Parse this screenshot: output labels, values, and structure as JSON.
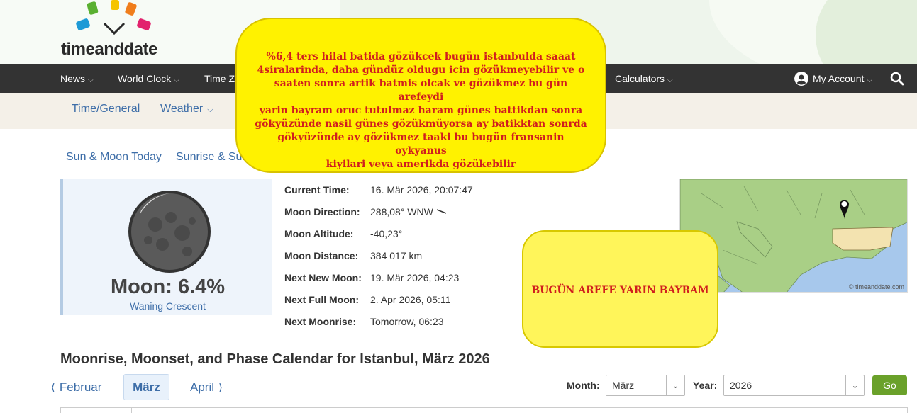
{
  "brand": {
    "logo_text": "timeanddate"
  },
  "topnav": {
    "items": [
      {
        "label": "News"
      },
      {
        "label": "World Clock"
      },
      {
        "label": "Time Zo"
      },
      {
        "label": "Calculators"
      }
    ],
    "account_label": "My Account"
  },
  "subnav": {
    "items": [
      {
        "label": "Time/General"
      },
      {
        "label": "Weather"
      }
    ]
  },
  "tabs": [
    {
      "label": "Sun & Moon Today"
    },
    {
      "label": "Sunrise & Sun"
    }
  ],
  "moon": {
    "percent": "Moon: 6.4%",
    "phase": "Waning Crescent"
  },
  "info": [
    {
      "label": "Current Time:",
      "value": "16. Mär 2026, 20:07:47"
    },
    {
      "label": "Moon Direction:",
      "value": "288,08° WNW"
    },
    {
      "label": "Moon Altitude:",
      "value": "-40,23°"
    },
    {
      "label": "Moon Distance:",
      "value": "384 017 km"
    },
    {
      "label": "Next New Moon:",
      "value": "19. Mär 2026, 04:23"
    },
    {
      "label": "Next Full Moon:",
      "value": "2. Apr 2026, 05:11"
    },
    {
      "label": "Next Moonrise:",
      "value": "Tomorrow, 06:23"
    }
  ],
  "map": {
    "credit": "© timeanddate.com"
  },
  "calendar": {
    "title": "Moonrise, Moonset, and Phase Calendar for Istanbul, März 2026",
    "prev_month": "Februar",
    "current_month": "März",
    "next_month": "April",
    "month_label": "Month:",
    "month_value": "März",
    "year_label": "Year:",
    "year_value": "2026",
    "go_label": "Go"
  },
  "annotations": {
    "bubble1_lines": [
      "%6,4 ters hilal batida gözükcek bugün istanbulda saaat",
      "4siralarinda,  daha gündüz oldugu icin gözükmeyebilir ve o",
      "saaten sonra artik batmis olcak ve gözükmez  bu gün arefeydi",
      "yarin bayram oruc tutulmaz haram günes battikdan sonra",
      "gökyüzünde nasil günes gözükmüyorsa ay batikktan sonrda",
      "gökyüzünde ay gözükmez taaki bu bugün fransanin oykyanus",
      "kiyilari veya amerikda gözükebilir"
    ],
    "bubble2": "BUGÜN AREFE YARIN BAYRAM"
  },
  "colors": {
    "nav_bg": "#333333",
    "link": "#3e6ea8",
    "go_button": "#6aa12a",
    "annotation_bg": "#fff200",
    "annotation_text": "#d01e1e"
  }
}
